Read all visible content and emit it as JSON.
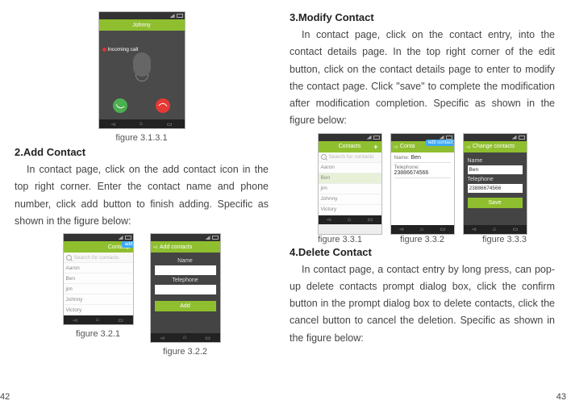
{
  "page_left": "42",
  "page_right": "43",
  "fig_3_1_3_1": {
    "caption": "figure 3.1.3.1",
    "header_name": "Johnny",
    "label": "Incoming call"
  },
  "section2": {
    "title": "2.Add Contact",
    "para": "In contact page, click on the add contact icon in the top right corner. Enter the contact name and phone number, click add button to finish adding. Specific as shown in the figure below:"
  },
  "fig_3_2_1": {
    "caption": "figure 3.2.1",
    "appbar": "Contacts",
    "search_ph": "Search for contacts",
    "rows": [
      "Aaron",
      "Ben",
      "jim",
      "Johnny",
      "Victory"
    ],
    "add_badge": "add contact"
  },
  "fig_3_2_2": {
    "caption": "figure 3.2.2",
    "appbar": "Add contacts",
    "name_label": "Name",
    "tel_label": "Telephone",
    "addbtn": "Add"
  },
  "section3": {
    "title": "3.Modify Contact",
    "para": "In contact page, click on the contact entry, into the contact details page. In the top right corner of the edit button, click on the contact details page to enter to modify the contact page. Click \"save\" to complete the modification after modification completion. Specific as shown in the figure below:"
  },
  "fig_3_3_1": {
    "caption": "figure 3.3.1"
  },
  "fig_3_3_2": {
    "caption": "figure 3.3.2",
    "appbar": "Conta",
    "edit": "edit contact",
    "name_label": "Name:",
    "name_val": "Ben",
    "tel_label": "Telephone:",
    "tel_val": "23886674566"
  },
  "fig_3_3_3": {
    "caption": "figure 3.3.3",
    "appbar": "Change contacts",
    "name_label": "Name",
    "name_val": "Ben",
    "tel_label": "Telephone",
    "tel_val": "23886674566",
    "savebtn": "Save"
  },
  "section4": {
    "title": "4.Delete Contact",
    "para": "In contact page, a contact entry by long press, can pop-up delete contacts prompt dialog box, click the confirm button in the prompt dialog box to delete contacts, click the cancel button to cancel the deletion. Specific as shown in the figure below:"
  }
}
